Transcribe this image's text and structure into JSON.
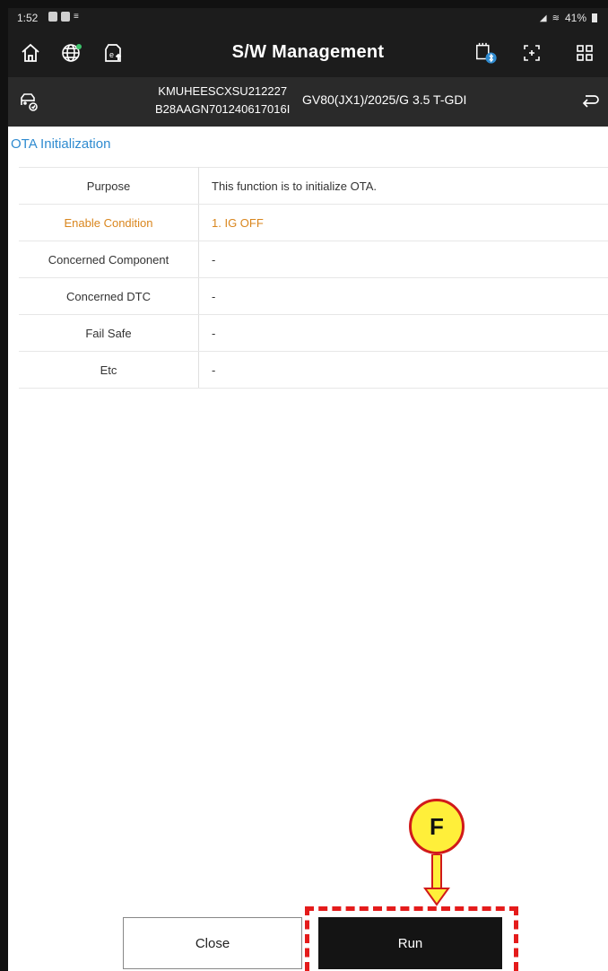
{
  "status_bar": {
    "time": "1:52",
    "battery": "41%"
  },
  "nav": {
    "title": "S/W Management"
  },
  "vehicle": {
    "vin_line1": "KMUHEESCXSU212227",
    "vin_line2": "B28AAGN701240617016I",
    "model": "GV80(JX1)/2025/G 3.5 T-GDI"
  },
  "section": {
    "title": "OTA Initialization"
  },
  "rows": [
    {
      "key": "Purpose",
      "value": "This function is to initialize OTA."
    },
    {
      "key": "Enable Condition",
      "value": "1. IG OFF"
    },
    {
      "key": "Concerned Component",
      "value": "-"
    },
    {
      "key": "Concerned DTC",
      "value": "-"
    },
    {
      "key": "Fail Safe",
      "value": "-"
    },
    {
      "key": "Etc",
      "value": "-"
    }
  ],
  "buttons": {
    "close": "Close",
    "run": "Run"
  },
  "annotation": {
    "marker_label": "F"
  },
  "colors": {
    "accent_blue": "#2f8bd0",
    "highlight_orange": "#d9861e",
    "annotation_red": "#e41b1b",
    "annotation_yellow": "#ffef3a"
  }
}
